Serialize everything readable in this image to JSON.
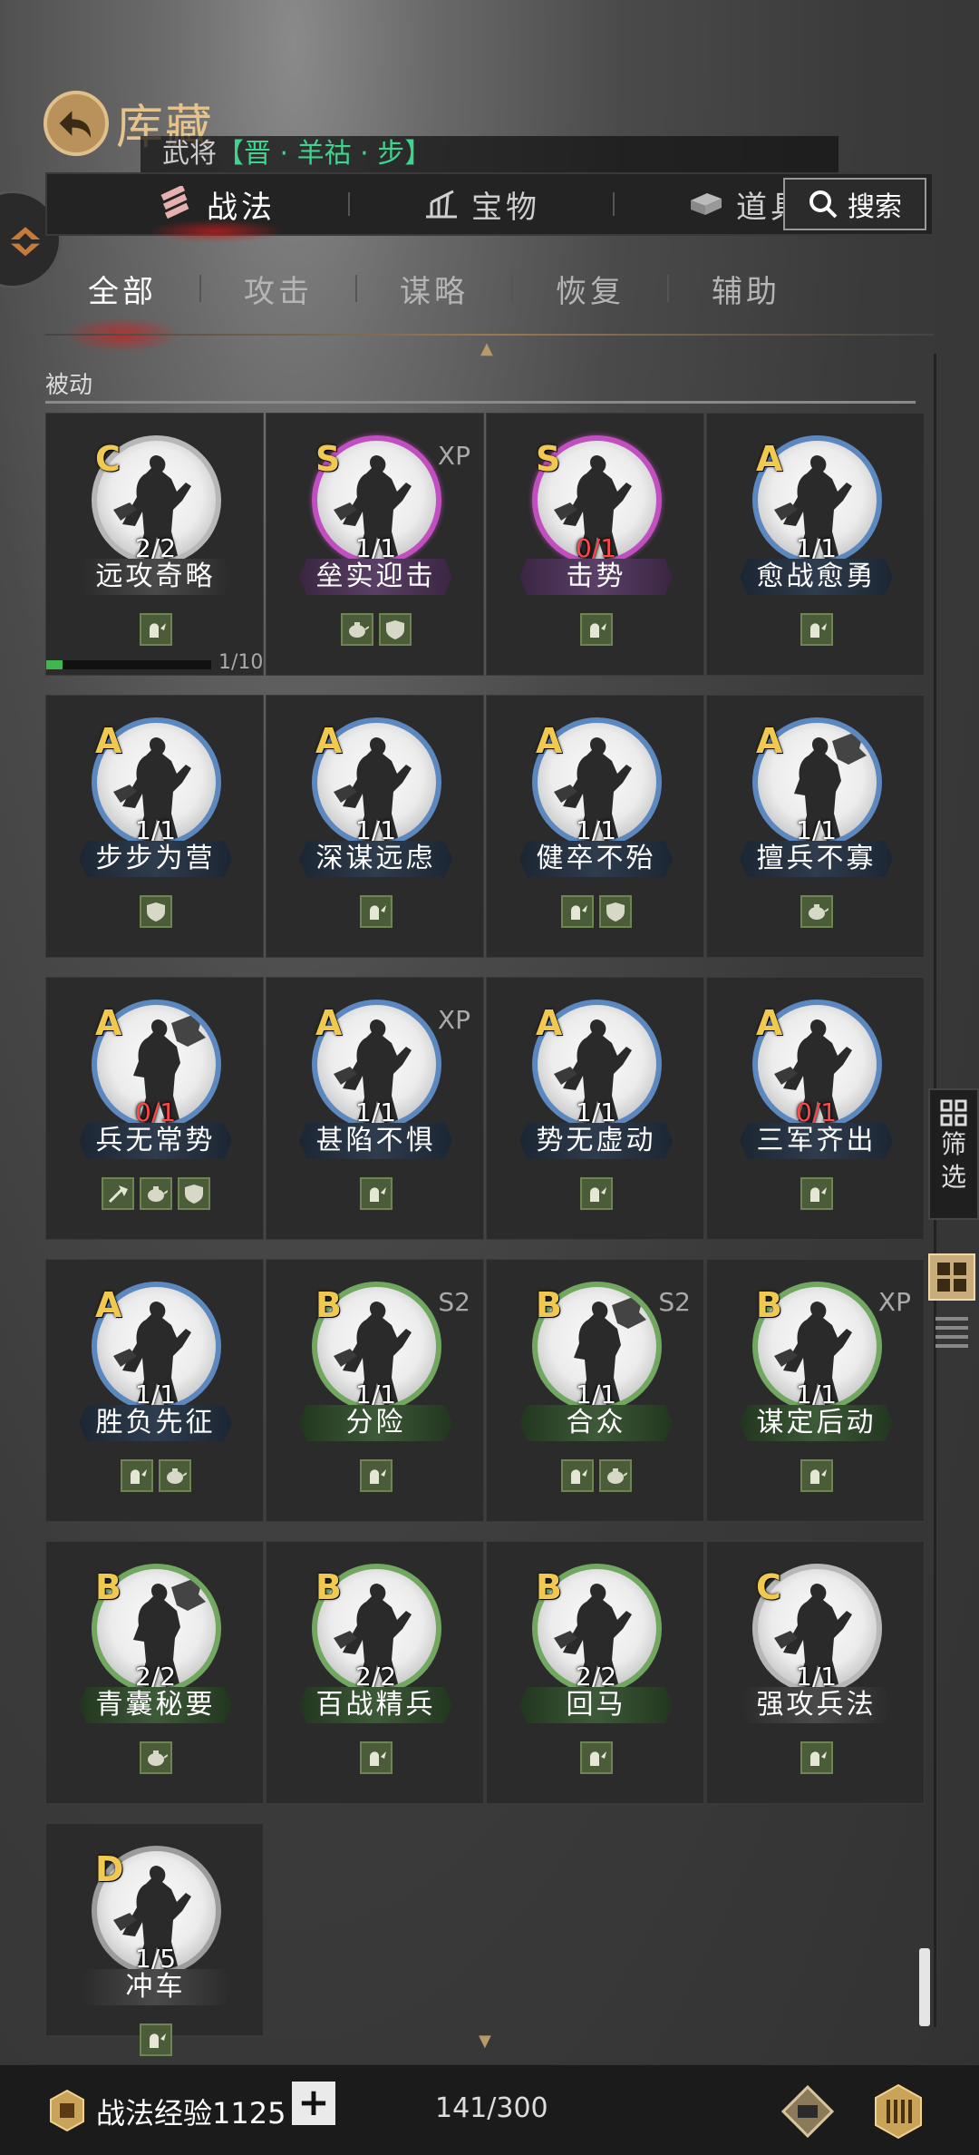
{
  "header": {
    "title": "库藏",
    "general_prefix": "武将",
    "general_name": "【晋 · 羊祜 · 步】"
  },
  "main_tabs": [
    {
      "label": "战法",
      "active": true
    },
    {
      "label": "宝物",
      "active": false
    },
    {
      "label": "道具",
      "active": false
    }
  ],
  "search": {
    "label": "搜索"
  },
  "sub_tabs": [
    {
      "label": "全部",
      "active": true
    },
    {
      "label": "攻击"
    },
    {
      "label": "谋略"
    },
    {
      "label": "恢复"
    },
    {
      "label": "辅助"
    }
  ],
  "section": {
    "label": "被动"
  },
  "cards": [
    {
      "grade": "C",
      "count": "2/2",
      "name": "远攻奇略",
      "tag": "",
      "traits": [
        "strength"
      ],
      "figure": "blade",
      "progress": {
        "value": 1,
        "max": 10,
        "text": "1/10"
      }
    },
    {
      "grade": "S",
      "count": "1/1",
      "name": "垒实迎击",
      "tag": "XP",
      "traits": [
        "teapot",
        "shield"
      ],
      "figure": "blade"
    },
    {
      "grade": "S",
      "count": "0/1",
      "name": "击势",
      "tag": "",
      "traits": [
        "strength"
      ],
      "figure": "blade"
    },
    {
      "grade": "A",
      "count": "1/1",
      "name": "愈战愈勇",
      "tag": "",
      "traits": [
        "strength"
      ],
      "figure": "blade"
    },
    {
      "grade": "A",
      "count": "1/1",
      "name": "步步为营",
      "tag": "",
      "traits": [
        "shield"
      ],
      "figure": "blade"
    },
    {
      "grade": "A",
      "count": "1/1",
      "name": "深谋远虑",
      "tag": "",
      "traits": [
        "strength"
      ],
      "figure": "blade"
    },
    {
      "grade": "A",
      "count": "1/1",
      "name": "健卒不殆",
      "tag": "",
      "traits": [
        "strength",
        "shield"
      ],
      "figure": "blade"
    },
    {
      "grade": "A",
      "count": "1/1",
      "name": "擅兵不寡",
      "tag": "",
      "traits": [
        "teapot"
      ],
      "figure": "fan"
    },
    {
      "grade": "A",
      "count": "0/1",
      "name": "兵无常势",
      "tag": "",
      "traits": [
        "axe",
        "teapot",
        "shield"
      ],
      "figure": "fan"
    },
    {
      "grade": "A",
      "count": "1/1",
      "name": "甚陷不惧",
      "tag": "XP",
      "traits": [
        "strength"
      ],
      "figure": "blade"
    },
    {
      "grade": "A",
      "count": "1/1",
      "name": "势无虚动",
      "tag": "",
      "traits": [
        "strength"
      ],
      "figure": "blade"
    },
    {
      "grade": "A",
      "count": "0/1",
      "name": "三军齐出",
      "tag": "",
      "traits": [
        "strength"
      ],
      "figure": "blade"
    },
    {
      "grade": "A",
      "count": "1/1",
      "name": "胜负先征",
      "tag": "",
      "traits": [
        "strength",
        "teapot"
      ],
      "figure": "blade"
    },
    {
      "grade": "B",
      "count": "1/1",
      "name": "分险",
      "tag": "S2",
      "traits": [
        "strength"
      ],
      "figure": "blade"
    },
    {
      "grade": "B",
      "count": "1/1",
      "name": "合众",
      "tag": "S2",
      "traits": [
        "strength",
        "teapot"
      ],
      "figure": "fan"
    },
    {
      "grade": "B",
      "count": "1/1",
      "name": "谋定后动",
      "tag": "XP",
      "traits": [
        "strength"
      ],
      "figure": "blade"
    },
    {
      "grade": "B",
      "count": "2/2",
      "name": "青囊秘要",
      "tag": "",
      "traits": [
        "teapot"
      ],
      "figure": "fan"
    },
    {
      "grade": "B",
      "count": "2/2",
      "name": "百战精兵",
      "tag": "",
      "traits": [
        "strength"
      ],
      "figure": "blade"
    },
    {
      "grade": "B",
      "count": "2/2",
      "name": "回马",
      "tag": "",
      "traits": [
        "strength"
      ],
      "figure": "blade"
    },
    {
      "grade": "C",
      "count": "1/1",
      "name": "强攻兵法",
      "tag": "",
      "traits": [
        "strength"
      ],
      "figure": "blade"
    },
    {
      "grade": "D",
      "count": "1/5",
      "name": "冲车",
      "tag": "",
      "traits": [
        "strength"
      ],
      "figure": "blade"
    }
  ],
  "filter": {
    "label_1": "筛",
    "label_2": "选"
  },
  "footer": {
    "exp_label": "战法经验",
    "exp_value": "1125",
    "plus": "+",
    "capacity": "141/300"
  },
  "colors": {
    "S": "#c14fc0",
    "A": "#5c88c0",
    "B": "#71a860",
    "C": "#b7b7b7",
    "D": "#9c9c9c",
    "accent": "#e6c38a"
  }
}
